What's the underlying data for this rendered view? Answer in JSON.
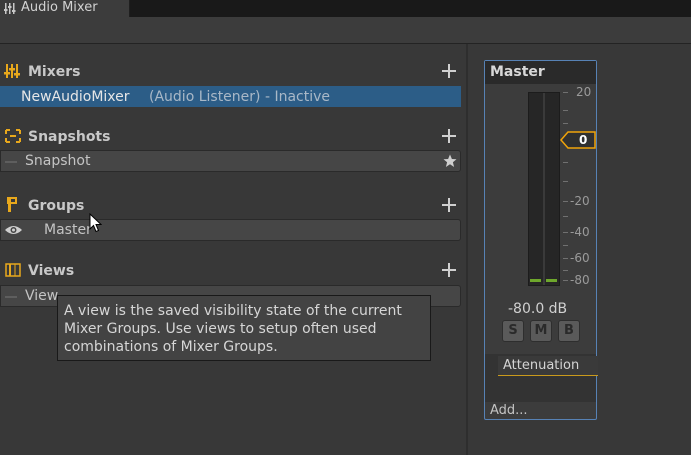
{
  "window": {
    "tab_title": "Audio Mixer"
  },
  "sections": {
    "mixers": {
      "title": "Mixers",
      "item_name": "NewAudioMixer",
      "item_status": "(Audio Listener) - Inactive"
    },
    "snapshots": {
      "title": "Snapshots",
      "item_name": "Snapshot"
    },
    "groups": {
      "title": "Groups",
      "item_name": "Master"
    },
    "views": {
      "title": "Views",
      "item_name": "View"
    }
  },
  "tooltip": {
    "lines": [
      "A view is the saved visibility state of the current",
      "Mixer Groups. Use views to setup often used",
      "combinations of Mixer Groups."
    ]
  },
  "strip": {
    "title": "Master",
    "scale_labels": [
      "20",
      "0",
      "-20",
      "-40",
      "-60",
      "-80"
    ],
    "fader_value": "0",
    "db_readout": "-80.0 dB",
    "buttons": {
      "solo": "S",
      "mute": "M",
      "bypass": "B"
    },
    "effect": "Attenuation",
    "add_label": "Add..."
  },
  "colors": {
    "selection": "#2c5d87",
    "accent": "#f0a30a",
    "meter_level": "#6ea72c",
    "strip_border": "#5782b5"
  },
  "icons": [
    "audio-mixer-icon",
    "mixer-icon",
    "snapshot-icon",
    "group-icon",
    "view-icon",
    "plus-icon",
    "star-icon",
    "eye-icon",
    "cursor-icon"
  ]
}
